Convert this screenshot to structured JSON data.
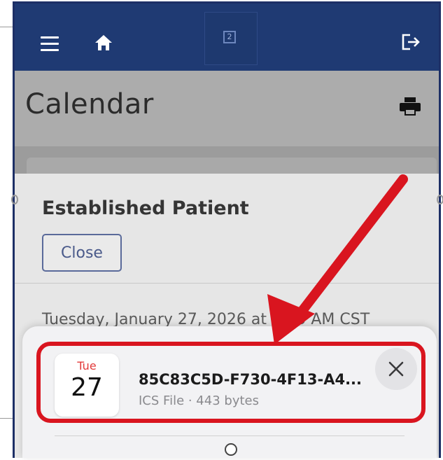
{
  "header": {
    "menu_icon": "hamburger-icon",
    "home_icon": "home-icon",
    "logout_icon": "logout-icon"
  },
  "page": {
    "title": "Calendar",
    "print_icon": "printer-icon"
  },
  "modal": {
    "title": "Established Patient",
    "close_label": "Close",
    "datetime": "Tuesday, January 27, 2026 at 9:15 AM CST"
  },
  "share_sheet": {
    "file": {
      "icon_day": "Tue",
      "icon_date": "27",
      "name": "85C83C5D-F730-4F13-A4...",
      "meta": "ICS File · 443 bytes"
    }
  },
  "colors": {
    "navbar": "#1f3a73",
    "annotation": "#d9151f",
    "calendar_day": "#e23a3a"
  }
}
